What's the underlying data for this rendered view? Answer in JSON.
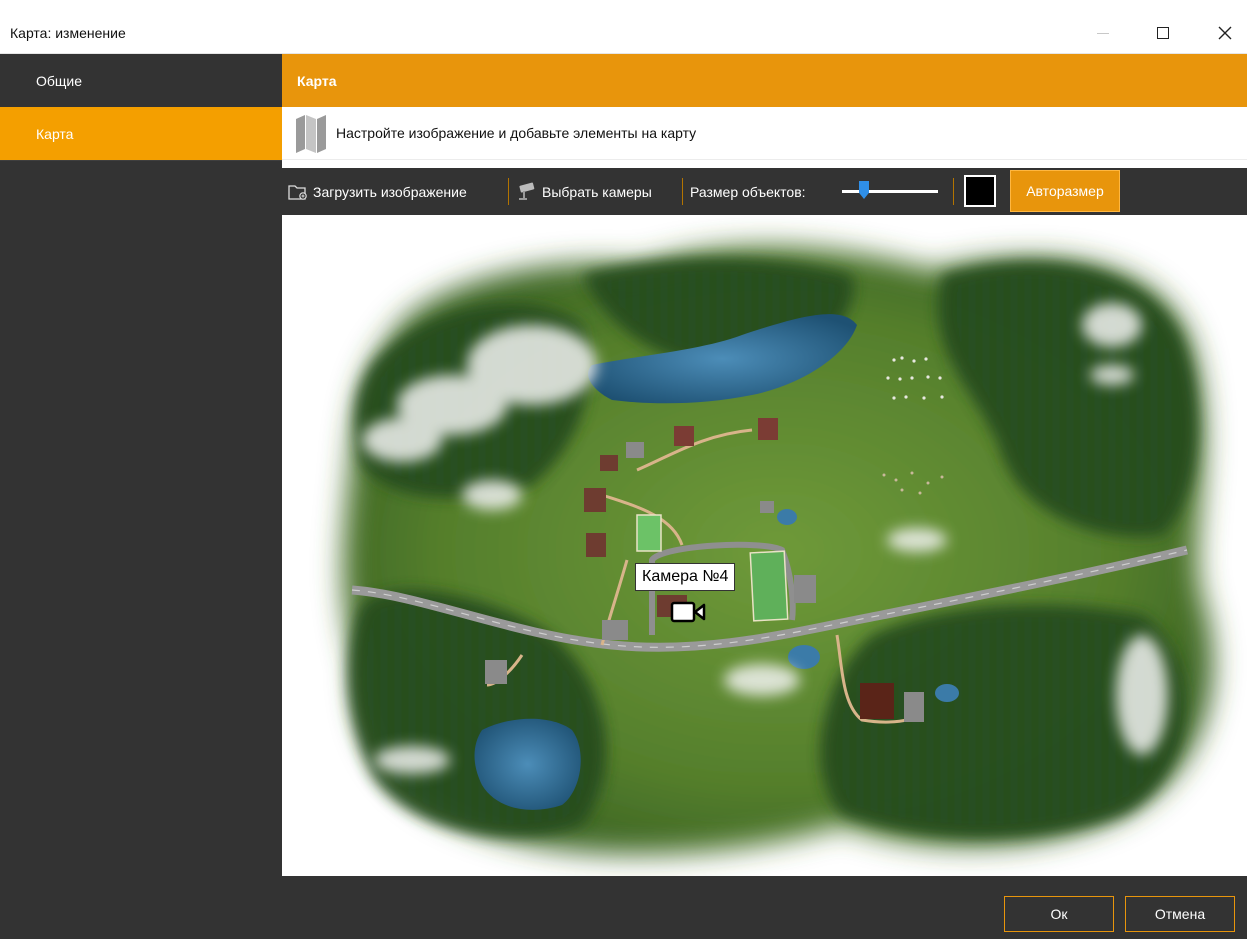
{
  "window": {
    "title": "Карта: изменение"
  },
  "sidebar": {
    "items": [
      {
        "label": "Общие",
        "active": false
      },
      {
        "label": "Карта",
        "active": true
      }
    ]
  },
  "section": {
    "title": "Карта"
  },
  "hint": {
    "icon": "map-icon",
    "text": "Настройте изображение и добавьте элементы на карту"
  },
  "toolbar": {
    "load_image_label": "Загрузить изображение",
    "select_cameras_label": "Выбрать камеры",
    "object_size_label": "Размер объектов:",
    "object_size_value": 0.2,
    "object_color": "#000000",
    "autosize_label": "Авторазмер"
  },
  "map": {
    "camera_label": "Камера №4"
  },
  "footer": {
    "ok_label": "Ок",
    "cancel_label": "Отмена"
  },
  "colors": {
    "accent": "#e8950c",
    "sidebar_bg": "#333333",
    "active_item": "#f49f00"
  }
}
